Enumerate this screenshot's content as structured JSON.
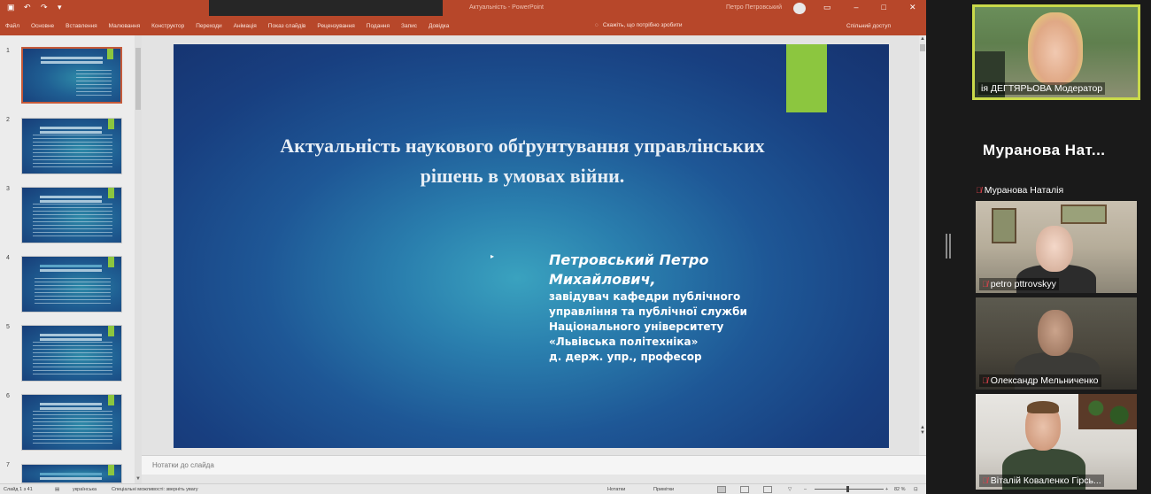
{
  "powerpoint": {
    "titlebar": {
      "doc_title": "Актуальність - PowerPoint",
      "user_name": "Петро Петровський"
    },
    "ribbon": {
      "tabs": [
        "Файл",
        "Основне",
        "Вставлення",
        "Малювання",
        "Конструктор",
        "Переходи",
        "Анімація",
        "Показ слайдів",
        "Рецензування",
        "Подання",
        "Запис",
        "Довідка"
      ],
      "tell_me": "Скажіть, що потрібно зробити",
      "share": "Спільний доступ"
    },
    "thumbnails": {
      "numbers": [
        "1",
        "2",
        "3",
        "4",
        "5",
        "6",
        "7"
      ]
    },
    "slide": {
      "title": "Актуальність наукового обґрунтування управлінських рішень в умовах війни.",
      "author_name": "Петровський Петро Михайлович,",
      "author_lines": [
        "завідувач кафедри публічного",
        "управління та публічної служби",
        "Національного університету",
        "«Львівська політехніка»",
        "д. держ. упр., професор"
      ],
      "accent_color": "#8cc63f"
    },
    "notes_placeholder": "Нотатки до слайда",
    "statusbar": {
      "slide_counter": "Слайд 1 з 41",
      "language": "українська",
      "accessibility": "Спеціальні можливості: зверніть увагу",
      "notes": "Нотатки",
      "comments": "Примітки",
      "zoom": "82 %"
    }
  },
  "zoom_panel": {
    "participants": [
      {
        "label": "ія ДЕГТЯРЬОВА Модератор",
        "muted": false,
        "active_speaker": true
      },
      {
        "label": "Муранова Наталія",
        "display_name": "Муранова Нат...",
        "muted": true,
        "video": false
      },
      {
        "label": "petro pttrovskyy",
        "muted": true
      },
      {
        "label": "Олександр Мельниченко",
        "muted": true
      },
      {
        "label": "Віталій Коваленко Гірсь...",
        "muted": true
      }
    ]
  }
}
